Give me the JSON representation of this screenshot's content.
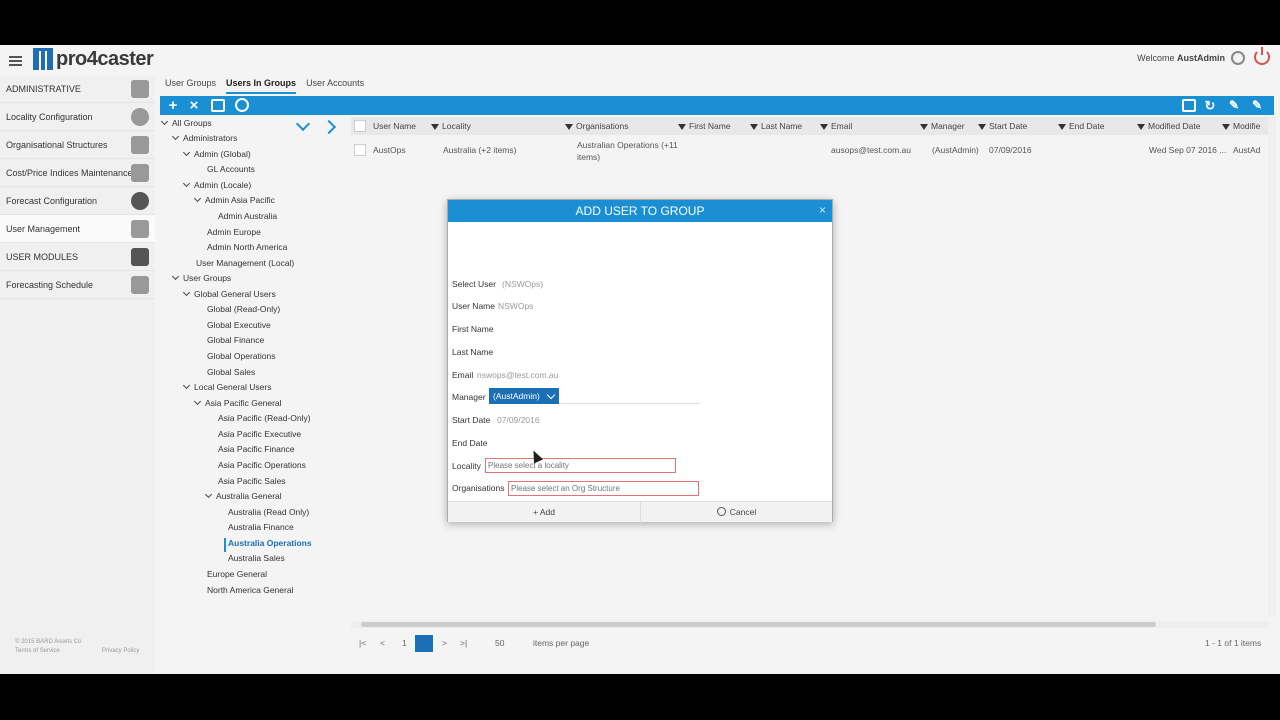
{
  "app": {
    "logo_text": "pro4caster",
    "welcome_prefix": "Welcome ",
    "welcome_user": "AustAdmin"
  },
  "sidebar": {
    "items": [
      {
        "label": "ADMINISTRATIVE",
        "icon": "briefcase-icon"
      },
      {
        "label": "Locality Configuration",
        "icon": "map-pin-icon"
      },
      {
        "label": "Organisational Structures",
        "icon": "org-chart-icon"
      },
      {
        "label": "Cost/Price Indices Maintenance",
        "icon": "arrows-updown-icon"
      },
      {
        "label": "Forecast Configuration",
        "icon": "forecast-icon"
      },
      {
        "label": "User Management",
        "icon": "users-icon"
      },
      {
        "label": "USER MODULES",
        "icon": "user-module-icon"
      },
      {
        "label": "Forecasting Schedule",
        "icon": "calendar-icon"
      }
    ],
    "footer_copyright": "© 2015 BARD Assets Co",
    "footer_terms": "Terms of Service",
    "footer_privacy": "Privacy Policy"
  },
  "tabs": [
    "User Groups",
    "Users In Groups",
    "User Accounts"
  ],
  "tree": [
    "All Groups",
    "Administrators",
    "Admin (Global)",
    "GL Accounts",
    "Admin (Locale)",
    "Admin Asia Pacific",
    "Admin Australia",
    "Admin Europe",
    "Admin North America",
    "User Management (Local)",
    "User Groups",
    "Global General Users",
    "Global (Read-Only)",
    "Global Executive",
    "Global Finance",
    "Global Operations",
    "Global Sales",
    "Local General Users",
    "Asia Pacific General",
    "Asia Pacific (Read-Only)",
    "Asia Pacific Executive",
    "Asia Pacific Finance",
    "Asia Pacific Operations",
    "Asia Pacific Sales",
    "Australia General",
    "Australia (Read Only)",
    "Australia Finance",
    "Australia Operations",
    "Australia Sales",
    "Europe General",
    "North America General"
  ],
  "grid": {
    "headers": [
      "User Name",
      "Locality",
      "Organisations",
      "First Name",
      "Last Name",
      "Email",
      "Manager",
      "Start Date",
      "End Date",
      "Modified Date",
      "Modifie"
    ],
    "row": {
      "user_name": "AustOps",
      "locality": "Australia (+2 items)",
      "organisations": "Australian Operations (+11 items)",
      "email": "ausops@test.com.au",
      "manager": "(AustAdmin)",
      "start_date": "07/09/2016",
      "modified_date": "Wed Sep 07 2016 ...",
      "modified_by": "AustAd"
    }
  },
  "pager": {
    "page": "1",
    "page_size": "50",
    "items_per_page": "items per page",
    "summary": "1 - 1 of 1 items"
  },
  "dialog": {
    "title": "ADD USER TO GROUP",
    "close": "×",
    "select_user_label": "Select User",
    "select_user_value": "(NSWOps)",
    "user_name_label": "User Name",
    "user_name_value": "NSWOps",
    "first_name_label": "First Name",
    "last_name_label": "Last Name",
    "email_label": "Email",
    "email_value": "nswops@test.com.au",
    "manager_label": "Manager",
    "manager_value": "(AustAdmin)",
    "start_date_label": "Start Date",
    "start_date_value": "07/09/2016",
    "end_date_label": "End Date",
    "locality_label": "Locality",
    "locality_placeholder": "Please select a locality",
    "organisations_label": "Organisations",
    "organisations_placeholder": "Please select an Org Structure",
    "add_button": "+ Add",
    "cancel_button": "Cancel"
  },
  "colors": {
    "accent": "#1a8fd4",
    "selected": "#1a6fb5",
    "invalid": "#e57373"
  }
}
